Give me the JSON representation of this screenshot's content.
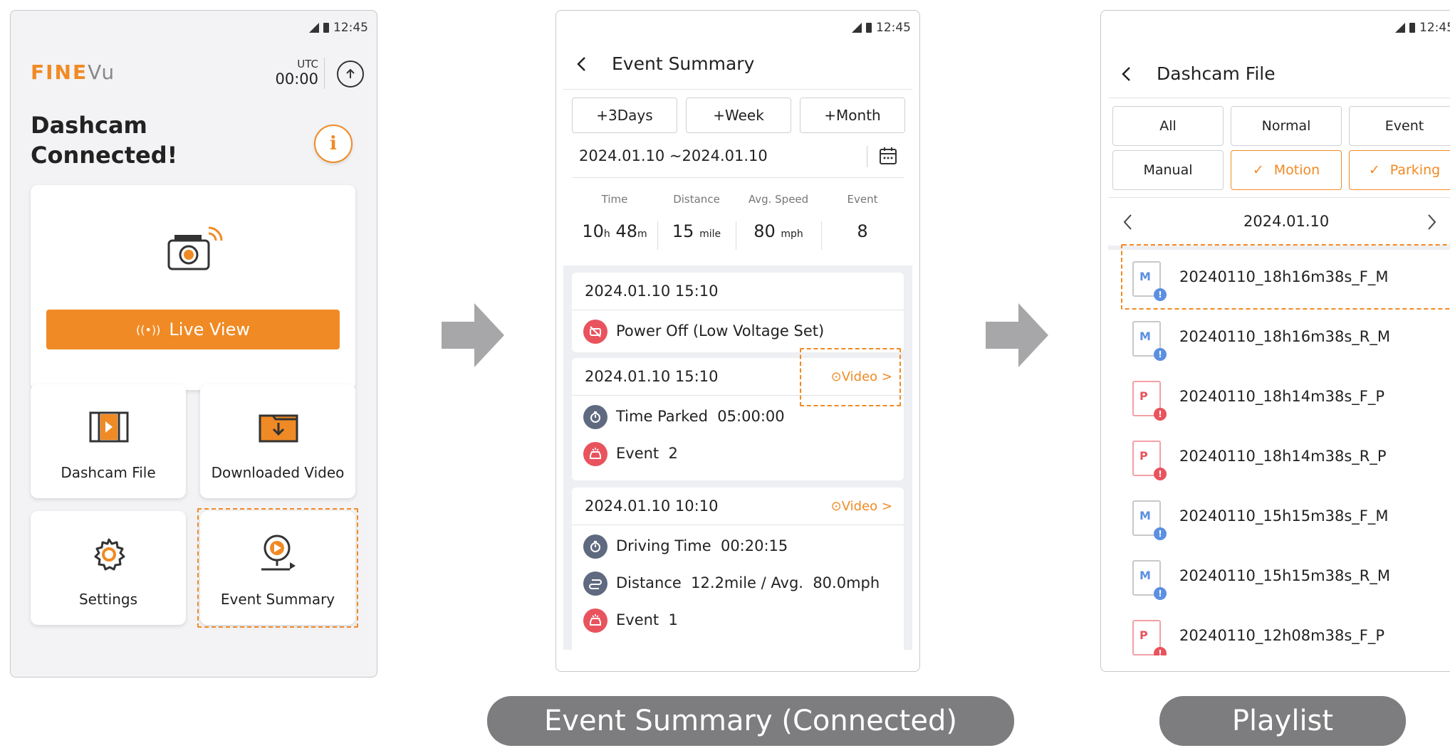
{
  "status": {
    "time": "12:45"
  },
  "home": {
    "logo_fine": "FINE",
    "logo_vu": "Vu",
    "utc_label": "UTC",
    "utc_time": "00:00",
    "title_line1": "Dashcam",
    "title_line2": "Connected!",
    "info_glyph": "i",
    "live_view_icon": "((•))",
    "live_view_label": "Live View",
    "tiles": [
      "Dashcam File",
      "Downloaded Video",
      "Settings",
      "Event Summary"
    ]
  },
  "summary": {
    "title": "Event Summary",
    "range_buttons": [
      "+3Days",
      "+Week",
      "+Month"
    ],
    "date_range": "2024.01.10 ~2024.01.10",
    "stats": {
      "headers": [
        "Time",
        "Distance",
        "Avg. Speed",
        "Event"
      ],
      "time_h": "10",
      "time_h_unit": "h",
      "time_m": "48",
      "time_m_unit": "m",
      "distance": "15",
      "distance_unit": "mile",
      "speed": "80",
      "speed_unit": "mph",
      "events": "8"
    },
    "groups": [
      {
        "timestamp": "2024.01.10 15:10",
        "items": [
          "Power Off (Low Voltage Set)"
        ]
      },
      {
        "timestamp": "2024.01.10 15:10",
        "video": "Video",
        "items": [
          "Time Parked  05:00:00",
          "Event  2"
        ]
      },
      {
        "timestamp": "2024.01.10 10:10",
        "video": "Video",
        "items": [
          "Driving Time  00:20:15",
          "Distance  12.2mile / Avg.  80.0mph",
          "Event  1"
        ]
      }
    ],
    "caption": "Event Summary (Connected)"
  },
  "playlist": {
    "title": "Dashcam File",
    "filters_row1": [
      "All",
      "Normal",
      "Event"
    ],
    "filters_row2": [
      "Manual",
      "Motion",
      "Parking"
    ],
    "date": "2024.01.10",
    "files": [
      {
        "badge": "M",
        "name": "20240110_18h16m38s_F_M",
        "kind": "motion"
      },
      {
        "badge": "M",
        "name": "20240110_18h16m38s_R_M",
        "kind": "motion"
      },
      {
        "badge": "P",
        "name": "20240110_18h14m38s_F_P",
        "kind": "parking"
      },
      {
        "badge": "P",
        "name": "20240110_18h14m38s_R_P",
        "kind": "parking"
      },
      {
        "badge": "M",
        "name": "20240110_15h15m38s_F_M",
        "kind": "motion"
      },
      {
        "badge": "M",
        "name": "20240110_15h15m38s_R_M",
        "kind": "motion"
      },
      {
        "badge": "P",
        "name": "20240110_12h08m38s_F_P",
        "kind": "parking"
      }
    ],
    "caption": "Playlist"
  },
  "colors": {
    "accent": "#f08a24",
    "event_red": "#e8535d",
    "motion_blue": "#5b8fe0",
    "slate": "#5f6a80"
  }
}
